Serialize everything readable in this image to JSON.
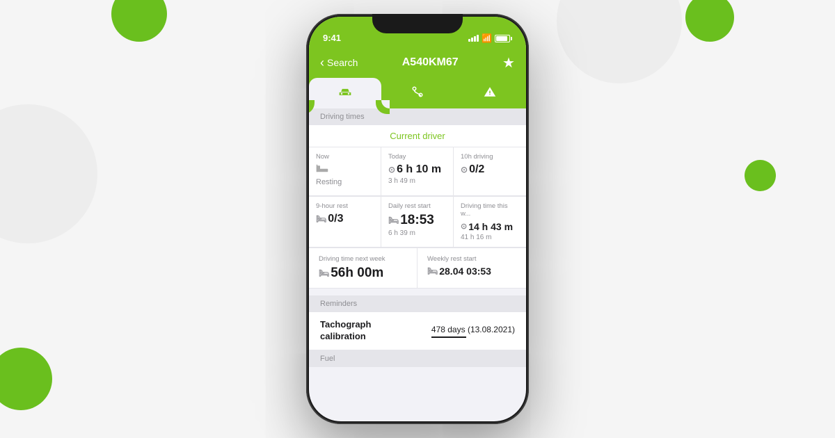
{
  "background": {
    "color": "#f5f5f5"
  },
  "status_bar": {
    "time": "9:41"
  },
  "nav": {
    "back_label": "Search",
    "title": "A540KM67",
    "star_icon": "★"
  },
  "tabs": [
    {
      "id": "car",
      "label": "car",
      "active": true
    },
    {
      "id": "route",
      "label": "route",
      "active": false
    },
    {
      "id": "warning",
      "label": "warning",
      "active": false
    }
  ],
  "sections": {
    "driving_times": {
      "header": "Driving times",
      "current_driver_label": "Current driver",
      "cards_row1": [
        {
          "label": "Now",
          "icon": "bed",
          "state": "Resting",
          "value": null,
          "sub": null
        },
        {
          "label": "Today",
          "icon": "clock",
          "value": "6 h 10 m",
          "sub": "3 h 49 m"
        },
        {
          "label": "10h driving",
          "icon": "clock",
          "value": "0/2",
          "sub": null
        }
      ],
      "cards_row2": [
        {
          "label": "9-hour rest",
          "icon": "bed",
          "value": "0/3",
          "sub": null
        },
        {
          "label": "Daily rest start",
          "icon": "bed",
          "value": "18:53",
          "sub": "6 h 39 m"
        },
        {
          "label": "Driving time this w...",
          "icon": "clock",
          "value": "14 h 43 m",
          "sub": "41 h 16 m"
        }
      ],
      "cards_row3": [
        {
          "label": "Driving time next week",
          "icon": "bed",
          "value": "56h 00m",
          "sub": null
        },
        {
          "label": "Weekly rest start",
          "icon": "bed",
          "value": "28.04 03:53",
          "sub": null
        }
      ]
    },
    "reminders": {
      "header": "Reminders",
      "items": [
        {
          "label": "Tachograph calibration",
          "value": "478 days (13.08.2021)"
        }
      ]
    },
    "fuel": {
      "header": "Fuel"
    }
  }
}
